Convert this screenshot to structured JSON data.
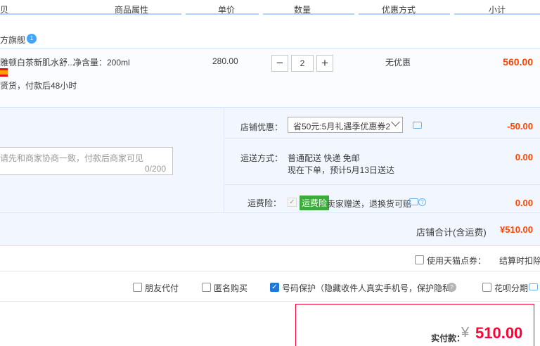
{
  "header": {
    "col_item": "贝",
    "col_attr": "商品属性",
    "col_price": "单价",
    "col_qty": "数量",
    "col_promo": "优惠方式",
    "col_subtotal": "小计"
  },
  "store": {
    "name": "方旗舰",
    "badge": "1"
  },
  "item": {
    "name": "雅顿白茶新肌水舒...",
    "sub_text": "贤货，付款后48小时",
    "attr": "净含量：200ml",
    "price": "280.00",
    "qty_minus": "−",
    "qty_value": "2",
    "qty_plus": "+",
    "promo": "无优惠",
    "subtotal": "560.00"
  },
  "message": {
    "placeholder": "请先和商家协商一致，付款后商家可见",
    "count": "0/200"
  },
  "coupon": {
    "label": "店铺优惠：",
    "selected": "省50元:5月礼遇季优惠券2",
    "amount": "-50.00"
  },
  "shipping": {
    "label": "运送方式：",
    "line1": "普通配送 快递 免邮",
    "line2": "现在下单，预计5月13日送达",
    "amount": "0.00"
  },
  "insurance": {
    "label": "运费险：",
    "check": "✓",
    "tag": "运费险",
    "text": "卖家赠送，退换货可赔",
    "help": "?",
    "amount": "0.00"
  },
  "store_total": {
    "label": "店铺合计(含运费)",
    "value": "¥510.00"
  },
  "tmall_points": {
    "label": "使用天猫点券：",
    "note": "结算时扣除"
  },
  "options": {
    "friend_pay": "朋友代付",
    "anonymous": "匿名购买",
    "number_protect": "号码保护（隐藏收件人真实手机号，保护隐私）",
    "number_protect_check": "✓",
    "help": "?",
    "huabei": "花呗分期"
  },
  "final": {
    "label": "实付款：",
    "currency": "¥",
    "amount": "510.00"
  },
  "colors": {
    "accent_red": "#ff4400",
    "final_red": "#ff0036",
    "blue_line": "#b2d1ff",
    "insurance_green": "#3cab3c"
  }
}
